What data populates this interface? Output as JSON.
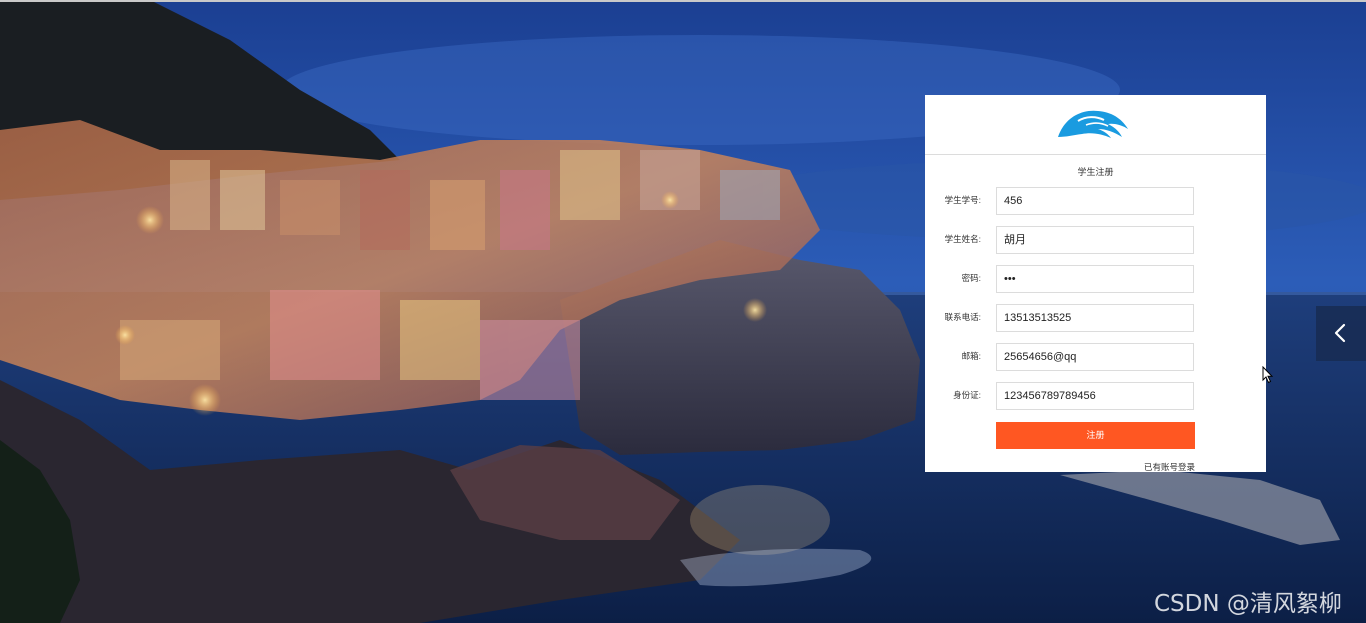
{
  "register_form": {
    "title": "学生注册",
    "fields": [
      {
        "label": "学生学号:",
        "value": "456"
      },
      {
        "label": "学生姓名:",
        "value": "胡月"
      },
      {
        "label": "密码:",
        "value": "•••"
      },
      {
        "label": "联系电话:",
        "value": "13513513525"
      },
      {
        "label": "邮箱:",
        "value": "25654656@qq"
      },
      {
        "label": "身份证:",
        "value": "123456789789456"
      }
    ],
    "submit_label": "注册",
    "login_link": "已有账号登录"
  },
  "logo_icon": "wave-hand-logo-icon",
  "side_toggle_icon": "chevron-left-icon",
  "watermark": "CSDN @清风絮柳",
  "colors": {
    "accent": "#ff5722",
    "logo_blue": "#1a9be0",
    "card_background": "#ffffff",
    "sky": "#2a56a8"
  }
}
